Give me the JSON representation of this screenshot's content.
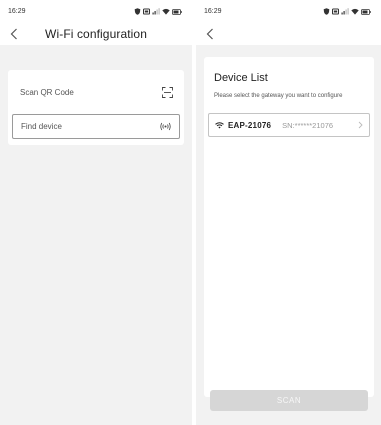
{
  "left_screen": {
    "status": {
      "time": "16:29"
    },
    "nav": {
      "title": "Wi-Fi configuration",
      "back_icon": "chevron-left-icon"
    },
    "options": [
      {
        "label": "Scan QR Code",
        "icon": "qr-scan-icon"
      },
      {
        "label": "Find device",
        "icon": "signal-broadcast-icon"
      }
    ]
  },
  "right_screen": {
    "status": {
      "time": "16:29"
    },
    "nav": {
      "back_icon": "chevron-left-icon"
    },
    "device_list": {
      "title": "Device List",
      "subtitle": "Please select the gateway you want to configure",
      "devices": [
        {
          "name": "EAP-21076",
          "sn": "SN:******21076",
          "icon": "wifi-icon"
        }
      ]
    },
    "scan_button_label": "SCAN"
  },
  "colors": {
    "background": "#f2f2f2",
    "card": "#ffffff",
    "disabled_button": "#d6d6d6"
  }
}
